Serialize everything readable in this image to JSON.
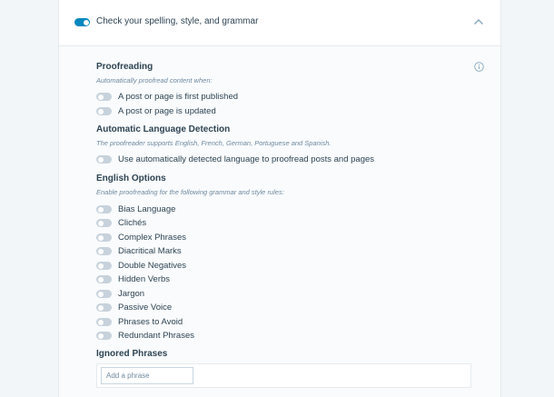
{
  "header": {
    "title": "Check your spelling, style, and grammar",
    "enabled": true
  },
  "proofreading": {
    "title": "Proofreading",
    "description": "Automatically proofread content when:",
    "options": [
      {
        "label": "A post or page is first published",
        "enabled": false
      },
      {
        "label": "A post or page is updated",
        "enabled": false
      }
    ]
  },
  "language_detection": {
    "title": "Automatic Language Detection",
    "description": "The proofreader supports English, French, German, Portuguese and Spanish.",
    "options": [
      {
        "label": "Use automatically detected language to proofread posts and pages",
        "enabled": false
      }
    ]
  },
  "english_options": {
    "title": "English Options",
    "description": "Enable proofreading for the following grammar and style rules:",
    "options": [
      {
        "label": "Bias Language",
        "enabled": false
      },
      {
        "label": "Clichés",
        "enabled": false
      },
      {
        "label": "Complex Phrases",
        "enabled": false
      },
      {
        "label": "Diacritical Marks",
        "enabled": false
      },
      {
        "label": "Double Negatives",
        "enabled": false
      },
      {
        "label": "Hidden Verbs",
        "enabled": false
      },
      {
        "label": "Jargon",
        "enabled": false
      },
      {
        "label": "Passive Voice",
        "enabled": false
      },
      {
        "label": "Phrases to Avoid",
        "enabled": false
      },
      {
        "label": "Redundant Phrases",
        "enabled": false
      }
    ]
  },
  "ignored_phrases": {
    "title": "Ignored Phrases",
    "input_value": "",
    "placeholder": "Add a phrase"
  },
  "icons": {
    "collapse": "chevron-up-icon",
    "info": "info-icon"
  },
  "colors": {
    "toggle_on": "#0087be",
    "toggle_off": "#c7d2dc",
    "text": "#2e4453",
    "muted": "#6f8aa0"
  }
}
